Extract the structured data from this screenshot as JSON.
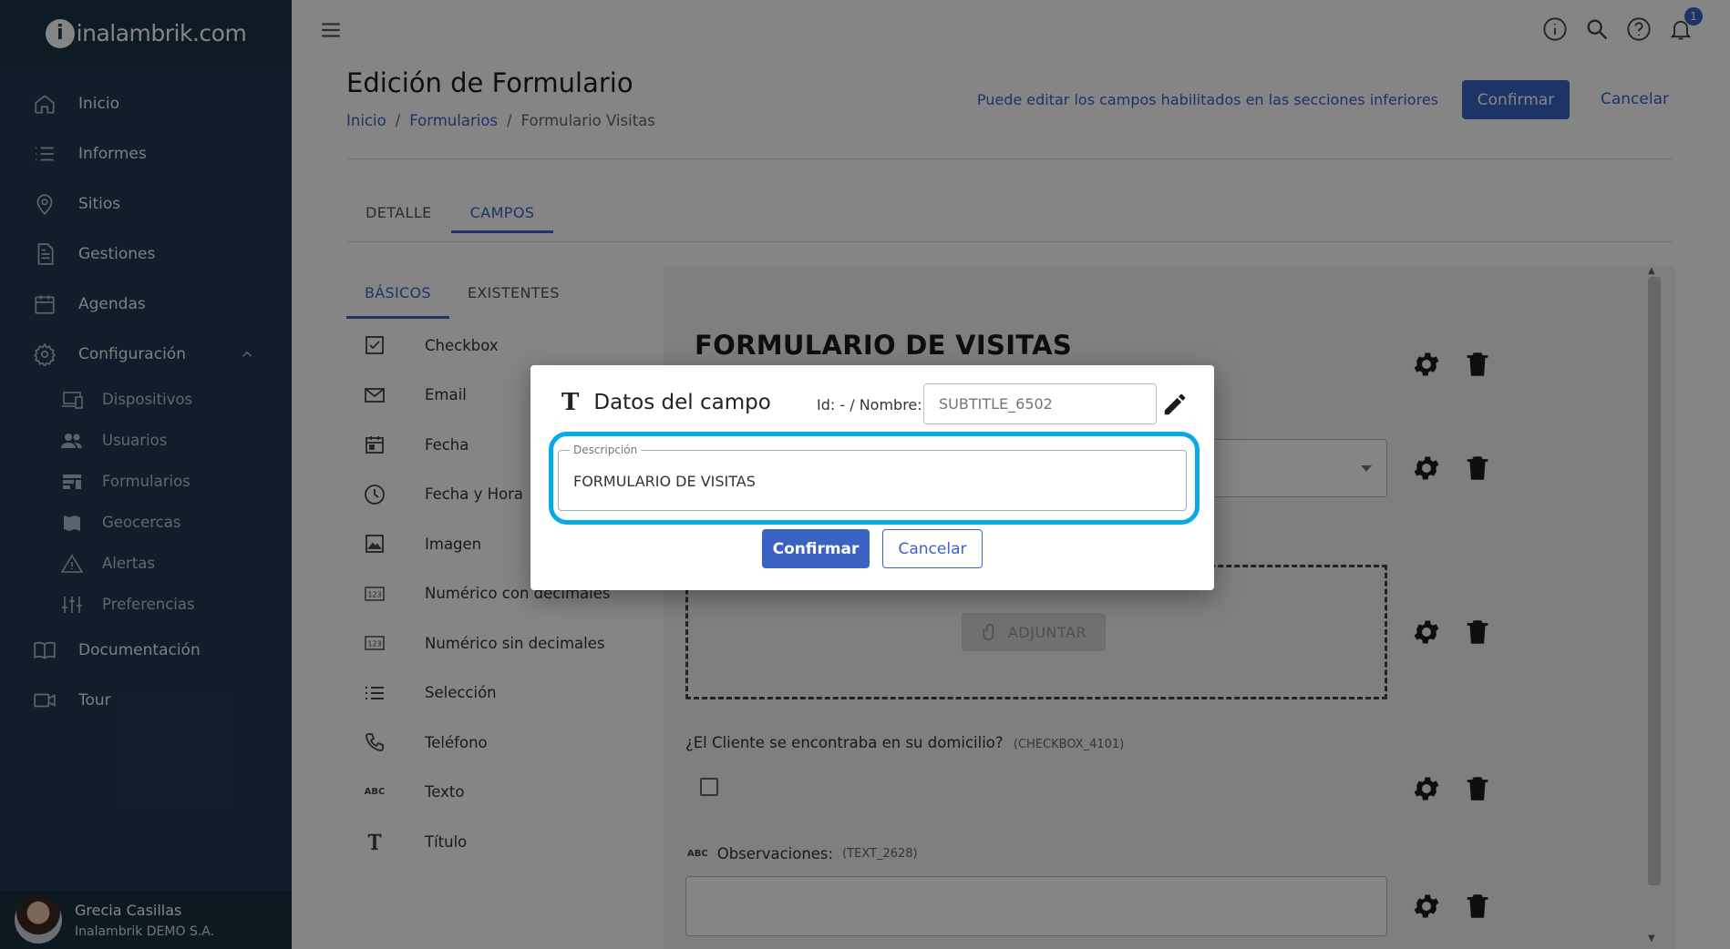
{
  "brand": {
    "logo_text": "inalambrik.com",
    "logo_letter": "in"
  },
  "sidebar": {
    "items": [
      {
        "label": "Inicio",
        "icon": "home-icon"
      },
      {
        "label": "Informes",
        "icon": "list-icon"
      },
      {
        "label": "Sitios",
        "icon": "map-pin-icon"
      },
      {
        "label": "Gestiones",
        "icon": "document-icon"
      },
      {
        "label": "Agendas",
        "icon": "calendar-icon"
      },
      {
        "label": "Configuración",
        "icon": "gear-icon",
        "expanded": true
      },
      {
        "label": "Documentación",
        "icon": "book-icon"
      },
      {
        "label": "Tour",
        "icon": "video-icon"
      }
    ],
    "sub_items": [
      {
        "label": "Dispositivos",
        "icon": "devices-icon"
      },
      {
        "label": "Usuarios",
        "icon": "users-icon"
      },
      {
        "label": "Formularios",
        "icon": "forms-icon"
      },
      {
        "label": "Geocercas",
        "icon": "map-icon"
      },
      {
        "label": "Alertas",
        "icon": "warning-icon"
      },
      {
        "label": "Preferencias",
        "icon": "sliders-icon"
      }
    ],
    "user": {
      "name": "Grecia Casillas",
      "org": "Inalambrik DEMO S.A."
    }
  },
  "topbar": {
    "notification_count": "1"
  },
  "page": {
    "title": "Edición de Formulario",
    "breadcrumb": [
      "Inicio",
      "Formularios",
      "Formulario Visitas"
    ],
    "hint": "Puede editar los campos habilitados en las secciones inferiores",
    "confirm_label": "Confirmar",
    "cancel_label": "Cancelar"
  },
  "tabs": [
    "DETALLE",
    "CAMPOS"
  ],
  "subtabs": [
    "BÁSICOS",
    "EXISTENTES"
  ],
  "field_types": [
    {
      "label": "Checkbox",
      "icon": "checkbox-icon"
    },
    {
      "label": "Email",
      "icon": "email-icon"
    },
    {
      "label": "Fecha",
      "icon": "calendar-icon"
    },
    {
      "label": "Fecha y Hora",
      "icon": "clock-icon"
    },
    {
      "label": "Imagen",
      "icon": "image-icon"
    },
    {
      "label": "Numérico con decimales",
      "icon": "numeric-icon"
    },
    {
      "label": "Numérico sin decimales",
      "icon": "numeric-icon"
    },
    {
      "label": "Selección",
      "icon": "list-icon"
    },
    {
      "label": "Teléfono",
      "icon": "phone-icon"
    },
    {
      "label": "Texto",
      "icon": "text-abc-icon"
    },
    {
      "label": "Título",
      "icon": "title-t-icon"
    }
  ],
  "form_canvas": {
    "form_title": "FORMULARIO DE VISITAS",
    "attach_label": "ADJUNTAR",
    "question_label": "¿El Cliente se encontraba en su domicilio?",
    "question_code": "(CHECKBOX_4101)",
    "obs_label": "Observaciones:",
    "obs_code": "(TEXT_2628)",
    "abc": "ABC"
  },
  "modal": {
    "title": "Datos del campo",
    "name_label": "Id: - / Nombre:",
    "name_placeholder": "SUBTITLE_6502",
    "desc_legend": "Descripción",
    "desc_value": "FORMULARIO DE VISITAS",
    "confirm_label": "Confirmar",
    "cancel_label": "Cancelar"
  },
  "colors": {
    "primary": "#3b63c4",
    "sidebar": "#1e3b52",
    "highlight": "#0aa8e6"
  }
}
